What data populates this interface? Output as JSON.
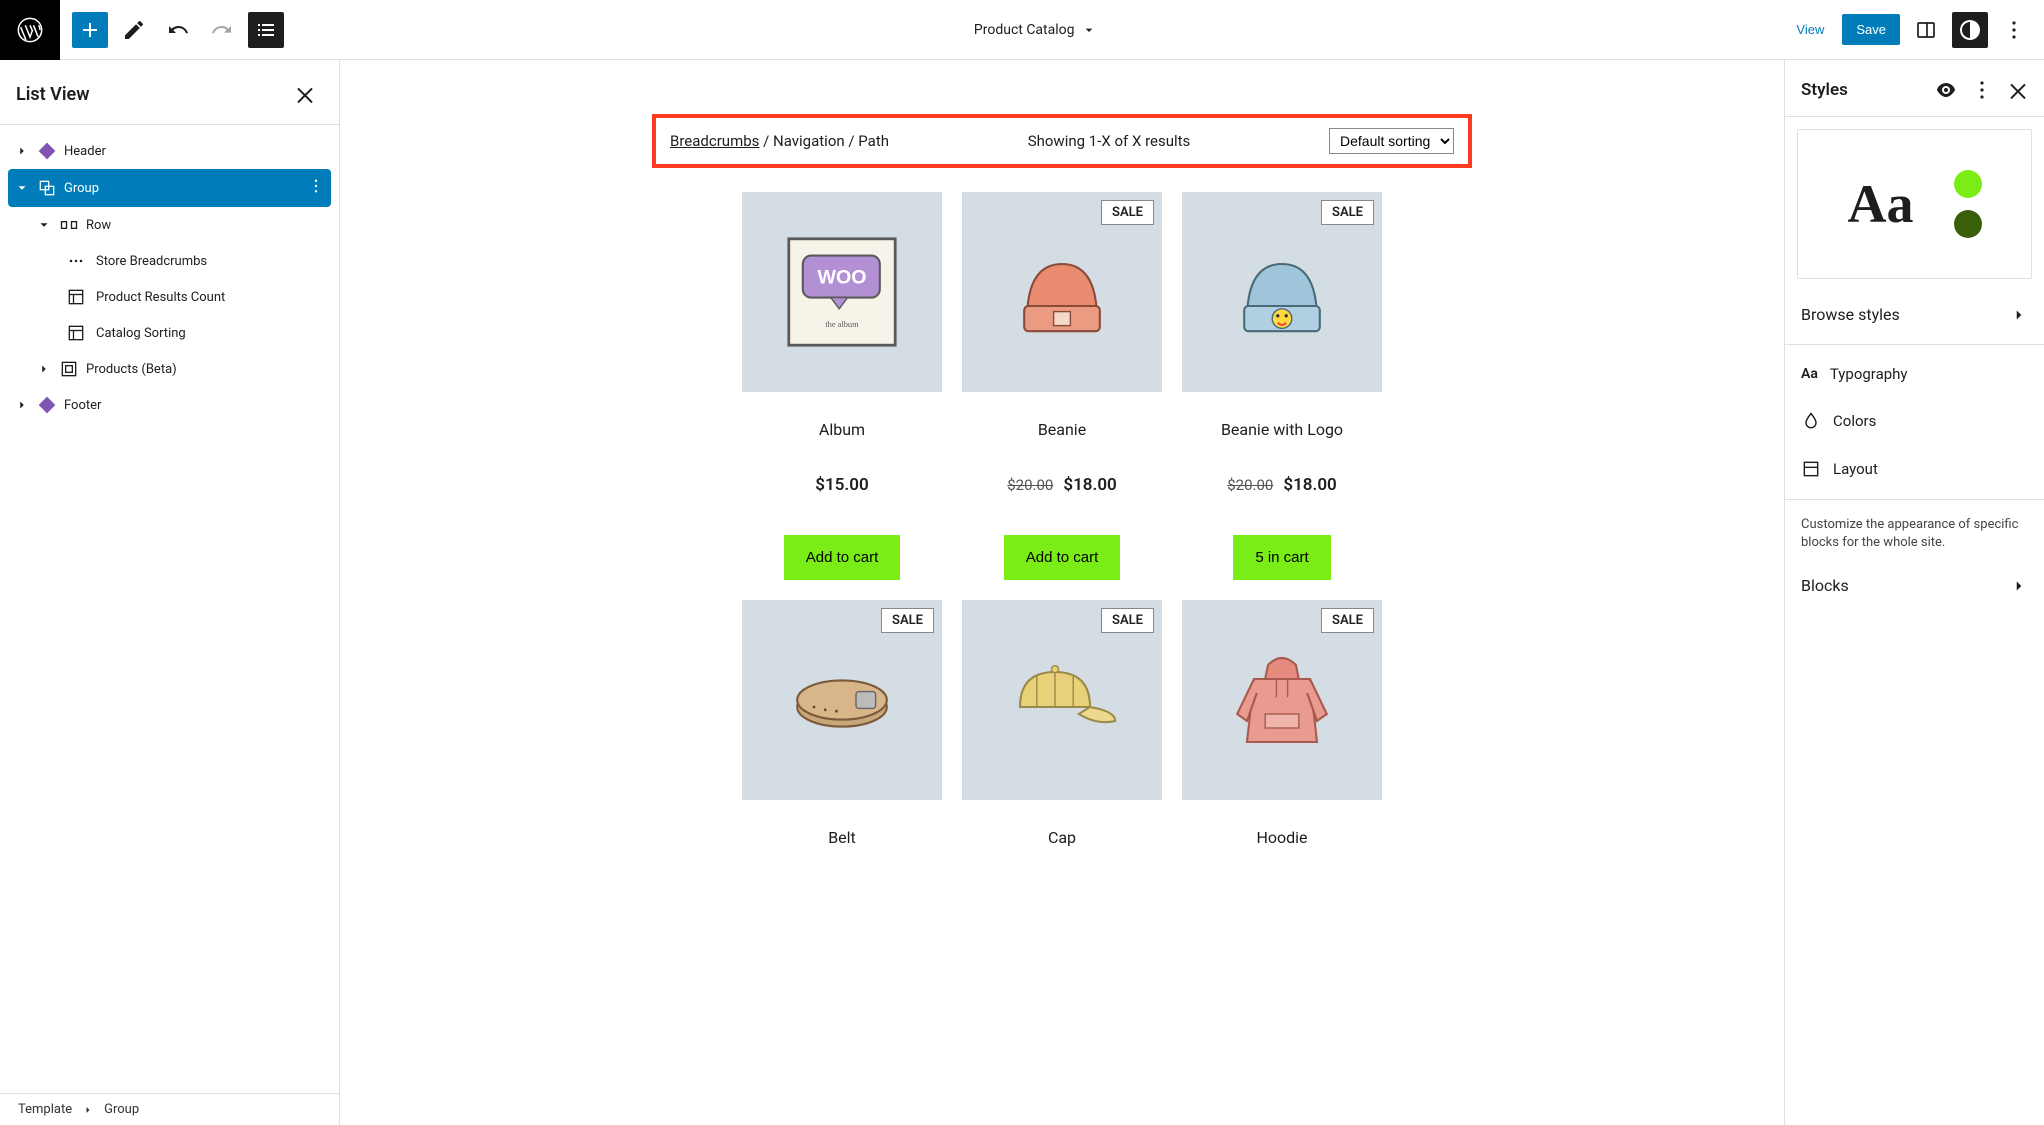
{
  "toolbar": {
    "document_title": "Product Catalog",
    "view": "View",
    "save": "Save"
  },
  "list_view": {
    "title": "List View",
    "items": {
      "header": "Header",
      "group": "Group",
      "row": "Row",
      "breadcrumbs": "Store Breadcrumbs",
      "results_count": "Product Results Count",
      "catalog_sorting": "Catalog Sorting",
      "products": "Products (Beta)",
      "footer": "Footer"
    }
  },
  "canvas": {
    "breadcrumb_underlined": "Breadcrumbs",
    "breadcrumb_rest": " / Navigation / Path",
    "results_text": "Showing 1-X of X results",
    "sort_label": "Default sorting",
    "sale_badge": "SALE",
    "products": [
      {
        "title": "Album",
        "price": "$15.00",
        "old_price": "",
        "sale": false,
        "btn": "Add to cart"
      },
      {
        "title": "Beanie",
        "price": "$18.00",
        "old_price": "$20.00",
        "sale": true,
        "btn": "Add to cart"
      },
      {
        "title": "Beanie with Logo",
        "price": "$18.00",
        "old_price": "$20.00",
        "sale": true,
        "btn": "5 in cart"
      },
      {
        "title": "Belt",
        "price": "",
        "old_price": "",
        "sale": true,
        "btn": ""
      },
      {
        "title": "Cap",
        "price": "",
        "old_price": "",
        "sale": true,
        "btn": ""
      },
      {
        "title": "Hoodie",
        "price": "",
        "old_price": "",
        "sale": true,
        "btn": ""
      }
    ]
  },
  "styles": {
    "title": "Styles",
    "aa": "Aa",
    "swatch1": "#7bed16",
    "swatch2": "#3a5f0b",
    "browse": "Browse styles",
    "typography": "Typography",
    "colors": "Colors",
    "layout": "Layout",
    "note": "Customize the appearance of specific blocks for the whole site.",
    "blocks": "Blocks"
  },
  "footer_crumb": {
    "a": "Template",
    "b": "Group"
  }
}
